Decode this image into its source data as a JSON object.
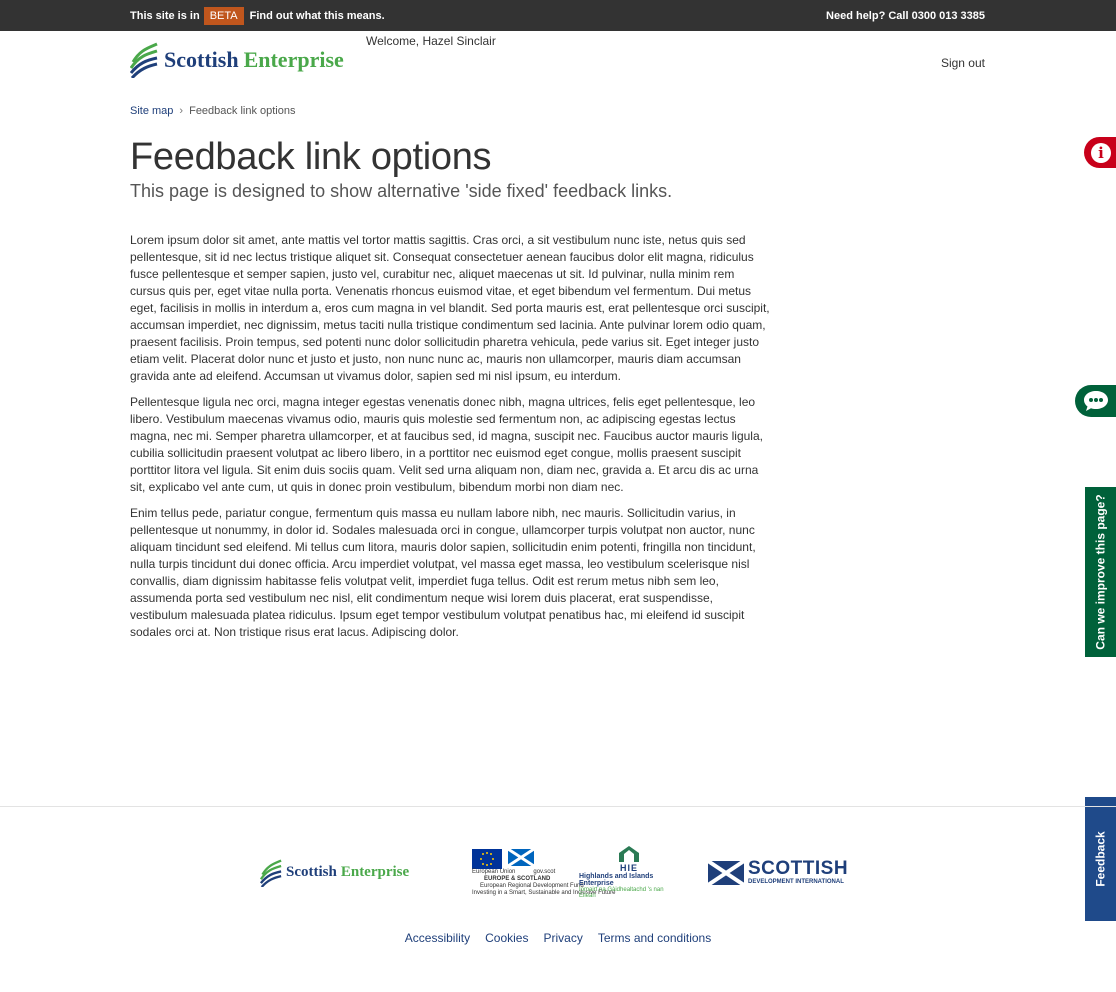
{
  "beta_bar": {
    "prefix": "This site is in",
    "badge": "BETA",
    "link": "Find out what this means.",
    "help": "Need help? Call 0300 013 3385"
  },
  "header": {
    "brand_part1": "Scottish",
    "brand_part2": "Enterprise",
    "welcome": "Welcome, Hazel Sinclair",
    "sign_out": "Sign out"
  },
  "breadcrumb": {
    "items": [
      "Site map",
      "Feedback link options"
    ]
  },
  "main": {
    "title": "Feedback link options",
    "subtitle": "This page is designed to show alternative 'side fixed' feedback links.",
    "paragraphs": [
      "Lorem ipsum dolor sit amet, ante mattis vel tortor mattis sagittis. Cras orci, a sit vestibulum nunc iste, netus quis sed pellentesque, sit id nec lectus tristique aliquet sit. Consequat consectetuer aenean faucibus dolor elit magna, ridiculus fusce pellentesque et semper sapien, justo vel, curabitur nec, aliquet maecenas ut sit. Id pulvinar, nulla minim rem cursus quis per, eget vitae nulla porta. Venenatis rhoncus euismod vitae, et eget bibendum vel fermentum. Dui metus eget, facilisis in mollis in interdum a, eros cum magna in vel blandit. Sed porta mauris est, erat pellentesque orci suscipit, accumsan imperdiet, nec dignissim, metus taciti nulla tristique condimentum sed lacinia. Ante pulvinar lorem odio quam, praesent facilisis. Proin tempus, sed potenti nunc dolor sollicitudin pharetra vehicula, pede varius sit. Eget integer justo etiam velit. Placerat dolor nunc et justo et justo, non nunc nunc ac, mauris non ullamcorper, mauris diam accumsan gravida ante ad eleifend. Accumsan ut vivamus dolor, sapien sed mi nisl ipsum, eu interdum.",
      "Pellentesque ligula nec orci, magna integer egestas venenatis donec nibh, magna ultrices, felis eget pellentesque, leo libero. Vestibulum maecenas vivamus odio, mauris quis molestie sed fermentum non, ac adipiscing egestas lectus magna, nec mi. Semper pharetra ullamcorper, et at faucibus sed, id magna, suscipit nec. Faucibus auctor mauris ligula, cubilia sollicitudin praesent volutpat ac libero libero, in a porttitor nec euismod eget congue, mollis praesent suscipit porttitor litora vel ligula. Sit enim duis sociis quam. Velit sed urna aliquam non, diam nec, gravida a. Et arcu dis ac urna sit, explicabo vel ante cum, ut quis in donec proin vestibulum, bibendum morbi non diam nec.",
      "Enim tellus pede, pariatur congue, fermentum quis massa eu nullam labore nibh, nec mauris. Sollicitudin varius, in pellentesque ut nonummy, in dolor id. Sodales malesuada orci in congue, ullamcorper turpis volutpat non auctor, nunc aliquam tincidunt sed eleifend. Mi tellus cum litora, mauris dolor sapien, sollicitudin enim potenti, fringilla non tincidunt, nulla turpis tincidunt dui donec officia. Arcu imperdiet volutpat, vel massa eget massa, leo vestibulum scelerisque nisl convallis, diam dignissim habitasse felis volutpat velit, imperdiet fuga tellus. Odit est rerum metus nibh sem leo, assumenda porta sed vestibulum nec nisl, elit condimentum neque wisi lorem duis placerat, erat suspendisse, vestibulum malesuada platea ridiculus. Ipsum eget tempor vestibulum volutpat penatibus hac, mi eleifend id suscipit sodales orci at. Non tristique risus erat lacus. Adipiscing dolor."
    ]
  },
  "side_tabs": {
    "info_icon": "info-icon",
    "chat_icon": "chat-bubble-icon",
    "improve_label": "Can we improve this page?",
    "feedback_label": "Feedback"
  },
  "footer": {
    "logos": {
      "se_part1": "Scottish",
      "se_part2": "Enterprise",
      "eu_line1": "European Union",
      "eu_gov": "gov.scot",
      "eu_line2": "EUROPE & SCOTLAND",
      "eu_line3": "European Regional Development Fund",
      "eu_line4": "Investing in a Smart, Sustainable and Inclusive Future",
      "hie_abbr": "HIE",
      "hie_name": "Highlands and Islands Enterprise",
      "hie_gaelic": "Iomairt na Gàidhealtachd 's nan Eilean",
      "sdi_big": "SCOTTISH",
      "sdi_small": "DEVELOPMENT INTERNATIONAL"
    },
    "links": [
      "Accessibility",
      "Cookies",
      "Privacy",
      "Terms and conditions"
    ]
  },
  "colors": {
    "beta_bar_bg": "#333333",
    "beta_badge": "#c0561d",
    "brand_navy": "#1f3f7a",
    "brand_green": "#4aa84a",
    "info_tab": "#c8001a",
    "green_tab": "#00613a",
    "feedback_tab": "#1f4a8a"
  }
}
